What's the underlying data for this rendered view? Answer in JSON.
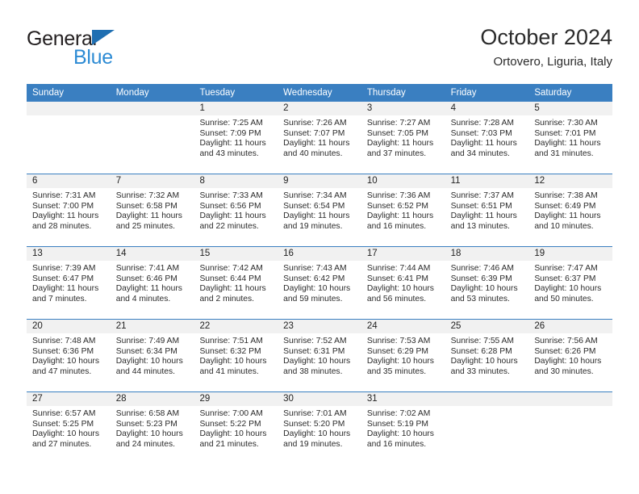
{
  "brand": {
    "line1": "General",
    "line2": "Blue",
    "triangle_color": "#1f6fb2",
    "blue_color": "#2d8bd4"
  },
  "header": {
    "title": "October 2024",
    "location": "Ortovero, Liguria, Italy"
  },
  "theme": {
    "header_blue": "#3a7fc1",
    "daynum_band": "#f1f1f1"
  },
  "weekdays": [
    "Sunday",
    "Monday",
    "Tuesday",
    "Wednesday",
    "Thursday",
    "Friday",
    "Saturday"
  ],
  "weeks": [
    [
      {
        "day": "",
        "lines": []
      },
      {
        "day": "",
        "lines": []
      },
      {
        "day": "1",
        "lines": [
          "Sunrise: 7:25 AM",
          "Sunset: 7:09 PM",
          "Daylight: 11 hours",
          "and 43 minutes."
        ]
      },
      {
        "day": "2",
        "lines": [
          "Sunrise: 7:26 AM",
          "Sunset: 7:07 PM",
          "Daylight: 11 hours",
          "and 40 minutes."
        ]
      },
      {
        "day": "3",
        "lines": [
          "Sunrise: 7:27 AM",
          "Sunset: 7:05 PM",
          "Daylight: 11 hours",
          "and 37 minutes."
        ]
      },
      {
        "day": "4",
        "lines": [
          "Sunrise: 7:28 AM",
          "Sunset: 7:03 PM",
          "Daylight: 11 hours",
          "and 34 minutes."
        ]
      },
      {
        "day": "5",
        "lines": [
          "Sunrise: 7:30 AM",
          "Sunset: 7:01 PM",
          "Daylight: 11 hours",
          "and 31 minutes."
        ]
      }
    ],
    [
      {
        "day": "6",
        "lines": [
          "Sunrise: 7:31 AM",
          "Sunset: 7:00 PM",
          "Daylight: 11 hours",
          "and 28 minutes."
        ]
      },
      {
        "day": "7",
        "lines": [
          "Sunrise: 7:32 AM",
          "Sunset: 6:58 PM",
          "Daylight: 11 hours",
          "and 25 minutes."
        ]
      },
      {
        "day": "8",
        "lines": [
          "Sunrise: 7:33 AM",
          "Sunset: 6:56 PM",
          "Daylight: 11 hours",
          "and 22 minutes."
        ]
      },
      {
        "day": "9",
        "lines": [
          "Sunrise: 7:34 AM",
          "Sunset: 6:54 PM",
          "Daylight: 11 hours",
          "and 19 minutes."
        ]
      },
      {
        "day": "10",
        "lines": [
          "Sunrise: 7:36 AM",
          "Sunset: 6:52 PM",
          "Daylight: 11 hours",
          "and 16 minutes."
        ]
      },
      {
        "day": "11",
        "lines": [
          "Sunrise: 7:37 AM",
          "Sunset: 6:51 PM",
          "Daylight: 11 hours",
          "and 13 minutes."
        ]
      },
      {
        "day": "12",
        "lines": [
          "Sunrise: 7:38 AM",
          "Sunset: 6:49 PM",
          "Daylight: 11 hours",
          "and 10 minutes."
        ]
      }
    ],
    [
      {
        "day": "13",
        "lines": [
          "Sunrise: 7:39 AM",
          "Sunset: 6:47 PM",
          "Daylight: 11 hours",
          "and 7 minutes."
        ]
      },
      {
        "day": "14",
        "lines": [
          "Sunrise: 7:41 AM",
          "Sunset: 6:46 PM",
          "Daylight: 11 hours",
          "and 4 minutes."
        ]
      },
      {
        "day": "15",
        "lines": [
          "Sunrise: 7:42 AM",
          "Sunset: 6:44 PM",
          "Daylight: 11 hours",
          "and 2 minutes."
        ]
      },
      {
        "day": "16",
        "lines": [
          "Sunrise: 7:43 AM",
          "Sunset: 6:42 PM",
          "Daylight: 10 hours",
          "and 59 minutes."
        ]
      },
      {
        "day": "17",
        "lines": [
          "Sunrise: 7:44 AM",
          "Sunset: 6:41 PM",
          "Daylight: 10 hours",
          "and 56 minutes."
        ]
      },
      {
        "day": "18",
        "lines": [
          "Sunrise: 7:46 AM",
          "Sunset: 6:39 PM",
          "Daylight: 10 hours",
          "and 53 minutes."
        ]
      },
      {
        "day": "19",
        "lines": [
          "Sunrise: 7:47 AM",
          "Sunset: 6:37 PM",
          "Daylight: 10 hours",
          "and 50 minutes."
        ]
      }
    ],
    [
      {
        "day": "20",
        "lines": [
          "Sunrise: 7:48 AM",
          "Sunset: 6:36 PM",
          "Daylight: 10 hours",
          "and 47 minutes."
        ]
      },
      {
        "day": "21",
        "lines": [
          "Sunrise: 7:49 AM",
          "Sunset: 6:34 PM",
          "Daylight: 10 hours",
          "and 44 minutes."
        ]
      },
      {
        "day": "22",
        "lines": [
          "Sunrise: 7:51 AM",
          "Sunset: 6:32 PM",
          "Daylight: 10 hours",
          "and 41 minutes."
        ]
      },
      {
        "day": "23",
        "lines": [
          "Sunrise: 7:52 AM",
          "Sunset: 6:31 PM",
          "Daylight: 10 hours",
          "and 38 minutes."
        ]
      },
      {
        "day": "24",
        "lines": [
          "Sunrise: 7:53 AM",
          "Sunset: 6:29 PM",
          "Daylight: 10 hours",
          "and 35 minutes."
        ]
      },
      {
        "day": "25",
        "lines": [
          "Sunrise: 7:55 AM",
          "Sunset: 6:28 PM",
          "Daylight: 10 hours",
          "and 33 minutes."
        ]
      },
      {
        "day": "26",
        "lines": [
          "Sunrise: 7:56 AM",
          "Sunset: 6:26 PM",
          "Daylight: 10 hours",
          "and 30 minutes."
        ]
      }
    ],
    [
      {
        "day": "27",
        "lines": [
          "Sunrise: 6:57 AM",
          "Sunset: 5:25 PM",
          "Daylight: 10 hours",
          "and 27 minutes."
        ]
      },
      {
        "day": "28",
        "lines": [
          "Sunrise: 6:58 AM",
          "Sunset: 5:23 PM",
          "Daylight: 10 hours",
          "and 24 minutes."
        ]
      },
      {
        "day": "29",
        "lines": [
          "Sunrise: 7:00 AM",
          "Sunset: 5:22 PM",
          "Daylight: 10 hours",
          "and 21 minutes."
        ]
      },
      {
        "day": "30",
        "lines": [
          "Sunrise: 7:01 AM",
          "Sunset: 5:20 PM",
          "Daylight: 10 hours",
          "and 19 minutes."
        ]
      },
      {
        "day": "31",
        "lines": [
          "Sunrise: 7:02 AM",
          "Sunset: 5:19 PM",
          "Daylight: 10 hours",
          "and 16 minutes."
        ]
      },
      {
        "day": "",
        "lines": []
      },
      {
        "day": "",
        "lines": []
      }
    ]
  ]
}
